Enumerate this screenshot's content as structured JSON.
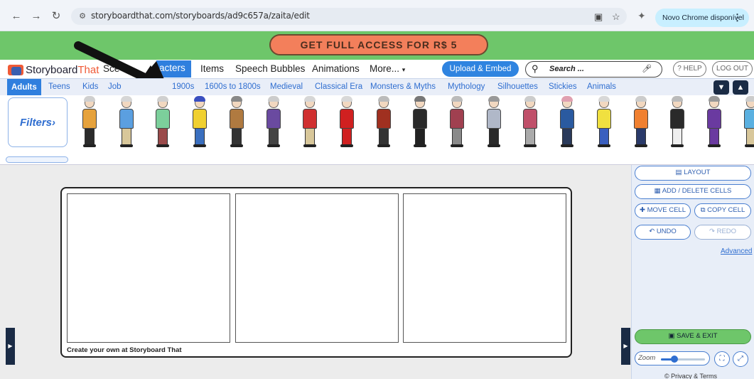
{
  "browser": {
    "url": "storyboardthat.com/storyboards/ad9c657a/zaita/edit",
    "update_label": "Novo Chrome disponível"
  },
  "promo": {
    "label": "GET FULL ACCESS FOR R$ 5"
  },
  "nav": {
    "logo_part1": "Storyboard",
    "logo_part2": "That",
    "items": [
      "Sce",
      "acters",
      "Items",
      "Speech Bubbles",
      "Animations",
      "More..."
    ],
    "upload": "Upload & Embed",
    "search_placeholder": "Search ...",
    "help": "? HELP",
    "logout": "LOG OUT"
  },
  "categories": {
    "tabs": [
      "Adults",
      "Teens",
      "Kids",
      "Job",
      "1900s",
      "1600s to 1800s",
      "Medieval",
      "Classical Era",
      "Monsters & Myths",
      "Mythology",
      "Silhouettes",
      "Stickies",
      "Animals"
    ]
  },
  "character_strip": {
    "filters": "Filters›",
    "characters": [
      {
        "shirt": "#e6a23c",
        "pants": "#2b2b2b",
        "hair": "#cfcfcf"
      },
      {
        "shirt": "#5b9fe0",
        "pants": "#d8c79a",
        "hair": "#d6d6d6"
      },
      {
        "shirt": "#7ccf9b",
        "pants": "#9a4a4a",
        "hair": "#d0d0d0"
      },
      {
        "shirt": "#f0d030",
        "pants": "#3a6fbf",
        "hair": "#3a4fc0"
      },
      {
        "shirt": "#b07a40",
        "pants": "#333333",
        "hair": "#888888"
      },
      {
        "shirt": "#6a4aa0",
        "pants": "#444444",
        "hair": "#cccccc"
      },
      {
        "shirt": "#d03030",
        "pants": "#d8c79a",
        "hair": "#d6d6d6"
      },
      {
        "shirt": "#d02020",
        "pants": "#d02020",
        "hair": "#d8d8d8"
      },
      {
        "shirt": "#a03020",
        "pants": "#333333",
        "hair": "#bbbbbb"
      },
      {
        "shirt": "#2a2a2a",
        "pants": "#222222",
        "hair": "#777777"
      },
      {
        "shirt": "#a04050",
        "pants": "#8a8a8a",
        "hair": "#bbbbbb"
      },
      {
        "shirt": "#b0b8c8",
        "pants": "#2a2a2a",
        "hair": "#999999"
      },
      {
        "shirt": "#c0506a",
        "pants": "#aaaaaa",
        "hair": "#cccccc"
      },
      {
        "shirt": "#2a5aa0",
        "pants": "#2a3a5a",
        "hair": "#e0a0b0"
      },
      {
        "shirt": "#f0e040",
        "pants": "#3a5fbf",
        "hair": "#d8d8d8"
      },
      {
        "shirt": "#f08030",
        "pants": "#2a3a6a",
        "hair": "#cccccc"
      },
      {
        "shirt": "#2a2a2a",
        "pants": "#eeeeee",
        "hair": "#bbbbbb"
      },
      {
        "shirt": "#6a3aa0",
        "pants": "#6a3aa0",
        "hair": "#999999"
      },
      {
        "shirt": "#5ab0e0",
        "pants": "#d8c79a",
        "hair": "#cccccc"
      }
    ]
  },
  "board": {
    "credit": "Create your own at Storyboard That"
  },
  "panel": {
    "layout": "LAYOUT",
    "add_delete": "ADD / DELETE CELLS",
    "move_cell": "MOVE CELL",
    "copy_cell": "COPY CELL",
    "undo": "UNDO",
    "redo": "REDO",
    "advanced": "Advanced",
    "save_exit": "SAVE & EXIT",
    "zoom_label": "Zoom",
    "zoom_level": 0.3,
    "privacy": "© Privacy & Terms"
  }
}
